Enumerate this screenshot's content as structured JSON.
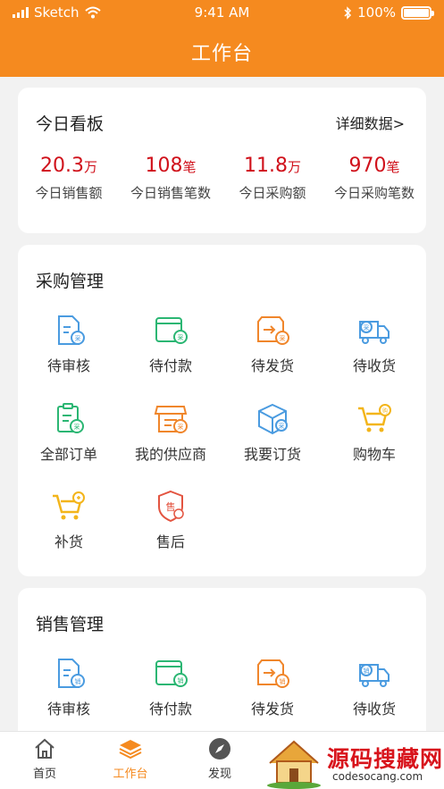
{
  "status_bar": {
    "carrier": "Sketch",
    "time": "9:41 AM",
    "battery": "100%",
    "battery_level": 1.0
  },
  "header": {
    "title": "工作台"
  },
  "dashboard": {
    "title": "今日看板",
    "detail_link": "详细数据>",
    "stats": [
      {
        "value": "20.3",
        "unit": "万",
        "label": "今日销售额"
      },
      {
        "value": "108",
        "unit": "笔",
        "label": "今日销售笔数"
      },
      {
        "value": "11.8",
        "unit": "万",
        "label": "今日采购额"
      },
      {
        "value": "970",
        "unit": "笔",
        "label": "今日采购笔数"
      }
    ]
  },
  "purchase": {
    "title": "采购管理",
    "items": [
      {
        "label": "待审核",
        "icon": "review-doc-icon"
      },
      {
        "label": "待付款",
        "icon": "wallet-icon"
      },
      {
        "label": "待发货",
        "icon": "ship-box-icon"
      },
      {
        "label": "待收货",
        "icon": "delivery-truck-icon"
      },
      {
        "label": "全部订单",
        "icon": "clipboard-order-icon"
      },
      {
        "label": "我的供应商",
        "icon": "storefront-icon"
      },
      {
        "label": "我要订货",
        "icon": "package-cube-icon"
      },
      {
        "label": "购物车",
        "icon": "shopping-cart-icon"
      },
      {
        "label": "补货",
        "icon": "restock-cart-icon"
      },
      {
        "label": "售后",
        "icon": "after-sales-shield-icon"
      }
    ],
    "badge": "采"
  },
  "sales": {
    "title": "销售管理",
    "items": [
      {
        "label": "待审核",
        "icon": "review-doc-icon"
      },
      {
        "label": "待付款",
        "icon": "wallet-icon"
      },
      {
        "label": "待发货",
        "icon": "ship-box-icon"
      },
      {
        "label": "待收货",
        "icon": "delivery-truck-icon"
      }
    ],
    "badge": "销"
  },
  "tabbar": {
    "tabs": [
      {
        "label": "首页",
        "icon": "home-icon"
      },
      {
        "label": "工作台",
        "icon": "layers-icon"
      },
      {
        "label": "发现",
        "icon": "compass-icon"
      }
    ]
  },
  "watermark": {
    "text": "源码搜藏网",
    "url": "codesocang.com"
  },
  "colors": {
    "brand": "#f58a1f",
    "stat_red": "#d0111b",
    "icon_blue": "#4a9be0",
    "icon_green": "#2bb673",
    "icon_orange": "#f0862b",
    "icon_yellow": "#f3b51b",
    "icon_red": "#e35440"
  }
}
